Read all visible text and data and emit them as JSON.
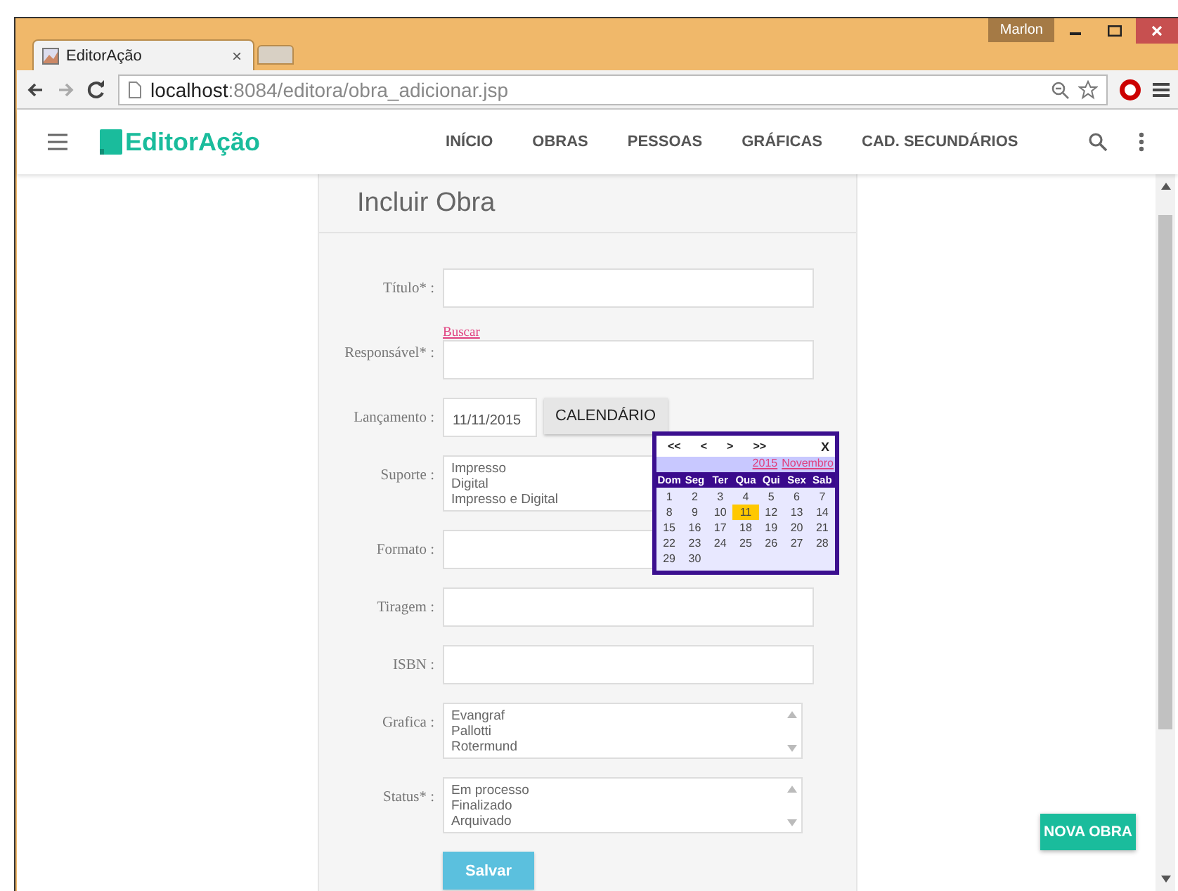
{
  "browser": {
    "tab_title": "EditorAção",
    "tab_close": "×",
    "url_host": "localhost",
    "url_path": ":8084/editora/obra_adicionar.jsp",
    "profile": "Marlon"
  },
  "app": {
    "logo": "EditorAção",
    "nav": [
      "INÍCIO",
      "OBRAS",
      "PESSOAS",
      "GRÁFICAS",
      "CAD. SECUNDÁRIOS"
    ]
  },
  "form": {
    "title": "Incluir Obra",
    "fields": [
      {
        "kind": "text",
        "label": "Título* :"
      },
      {
        "kind": "text",
        "label": "Responsável* :",
        "link": "Buscar"
      },
      {
        "kind": "date",
        "label": "Lançamento :",
        "value": "11/11/2015",
        "button": "CALENDÁRIO"
      },
      {
        "kind": "list",
        "label": "Suporte :",
        "options": [
          "Impresso",
          "Digital",
          "Impresso e Digital"
        ],
        "scrollbar": false
      },
      {
        "kind": "text",
        "label": "Formato :"
      },
      {
        "kind": "text",
        "label": "Tiragem :"
      },
      {
        "kind": "text",
        "label": "ISBN :"
      },
      {
        "kind": "list",
        "label": "Grafica :",
        "options": [
          "Evangraf",
          "Pallotti",
          "Rotermund"
        ],
        "scrollbar": true
      },
      {
        "kind": "list",
        "label": "Status* :",
        "options": [
          "Em processo",
          "Finalizado",
          "Arquivado"
        ],
        "scrollbar": true
      }
    ],
    "submit": "Salvar"
  },
  "calendar": {
    "nav": [
      "<<",
      "<",
      ">",
      ">>"
    ],
    "close": "X",
    "year": "2015",
    "month": "Novembro",
    "weekdays": [
      "Dom",
      "Seg",
      "Ter",
      "Qua",
      "Qui",
      "Sex",
      "Sab"
    ],
    "days": [
      {
        "label": "1",
        "selected": false
      },
      {
        "label": "2",
        "selected": false
      },
      {
        "label": "3",
        "selected": false
      },
      {
        "label": "4",
        "selected": false
      },
      {
        "label": "5",
        "selected": false
      },
      {
        "label": "6",
        "selected": false
      },
      {
        "label": "7",
        "selected": false
      },
      {
        "label": "8",
        "selected": false
      },
      {
        "label": "9",
        "selected": false
      },
      {
        "label": "10",
        "selected": false
      },
      {
        "label": "11",
        "selected": true
      },
      {
        "label": "12",
        "selected": false
      },
      {
        "label": "13",
        "selected": false
      },
      {
        "label": "14",
        "selected": false
      },
      {
        "label": "15",
        "selected": false
      },
      {
        "label": "16",
        "selected": false
      },
      {
        "label": "17",
        "selected": false
      },
      {
        "label": "18",
        "selected": false
      },
      {
        "label": "19",
        "selected": false
      },
      {
        "label": "20",
        "selected": false
      },
      {
        "label": "21",
        "selected": false
      },
      {
        "label": "22",
        "selected": false
      },
      {
        "label": "23",
        "selected": false
      },
      {
        "label": "24",
        "selected": false
      },
      {
        "label": "25",
        "selected": false
      },
      {
        "label": "26",
        "selected": false
      },
      {
        "label": "27",
        "selected": false
      },
      {
        "label": "28",
        "selected": false
      },
      {
        "label": "29",
        "selected": false
      },
      {
        "label": "30",
        "selected": false
      }
    ]
  },
  "fab": "NOVA OBRA"
}
